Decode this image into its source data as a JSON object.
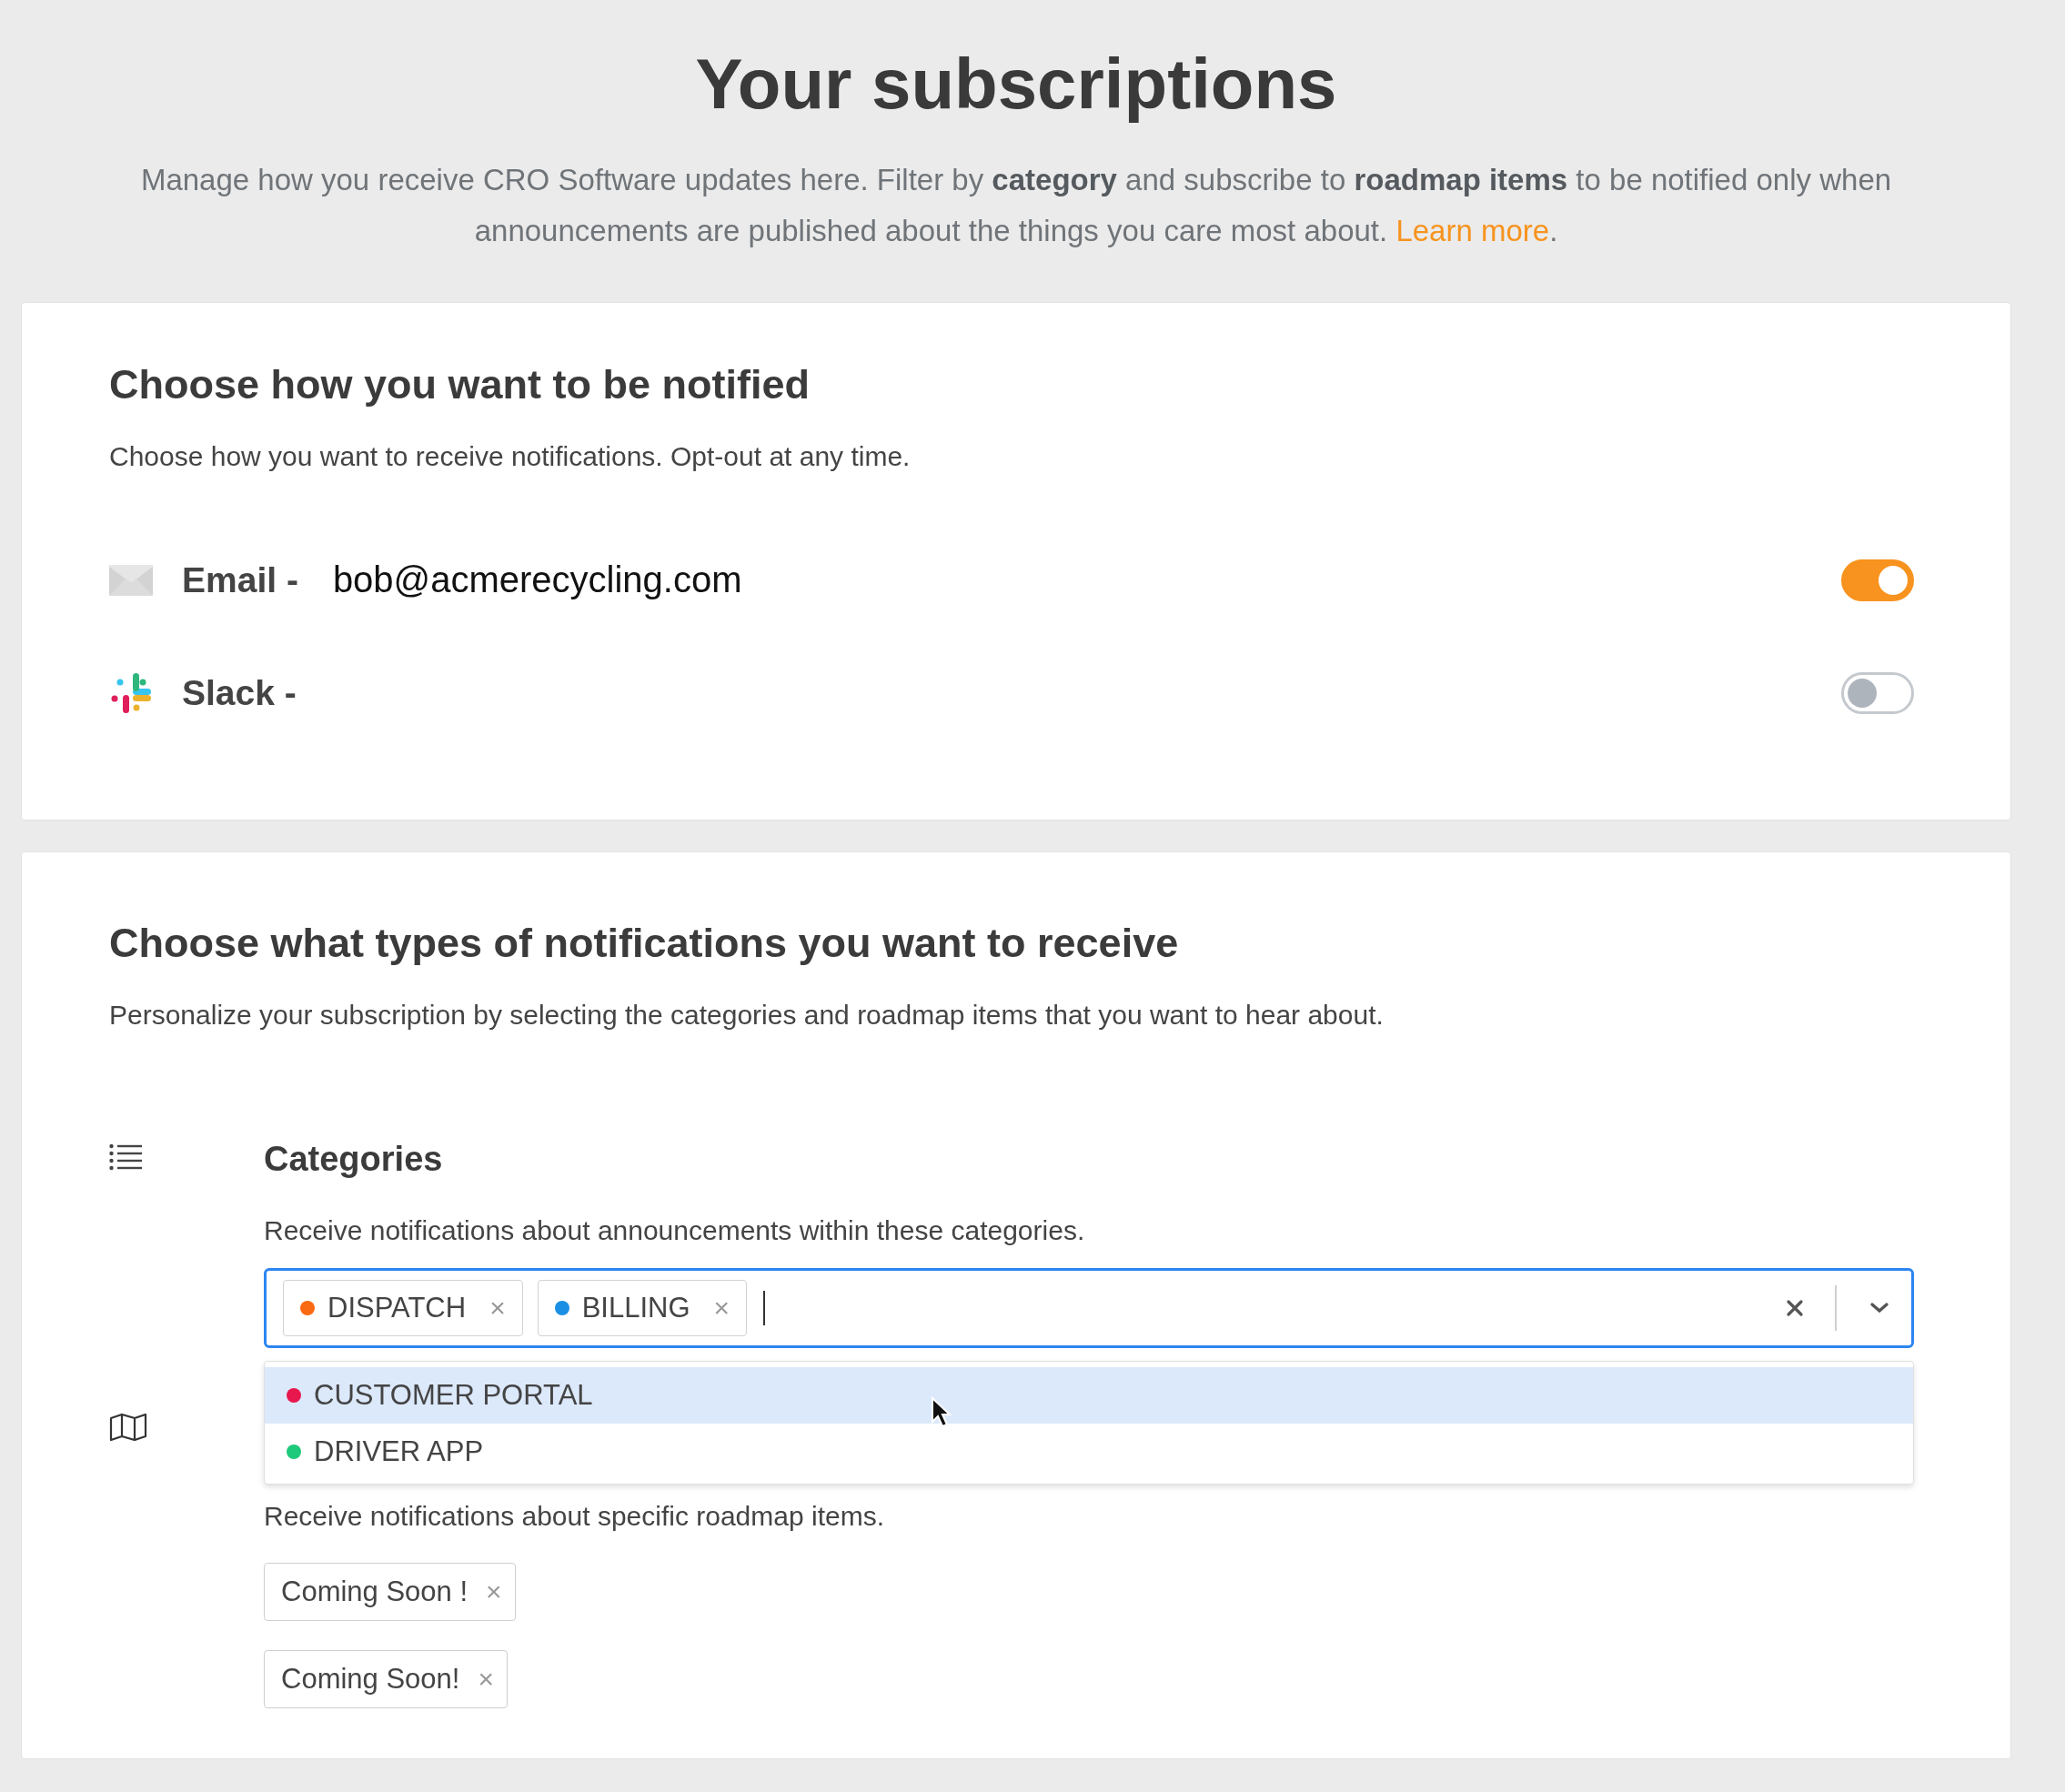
{
  "page_title": "Your subscriptions",
  "intro": {
    "text": "Manage how you receive CRO Software updates here. Filter by **category** and subscribe to **roadmap items** to be notified only when announcements are published about the things you care most about.",
    "link": "Learn more",
    "after": "."
  },
  "notify_card": {
    "title": "Choose how you want to be notified",
    "description": "Choose how you want to receive notifications. Opt-out at any time.",
    "channels": [
      {
        "kind": "email",
        "label": "Email -",
        "value": "bob@acmerecycling.com",
        "on": true
      },
      {
        "kind": "slack",
        "label": "Slack -",
        "on": false
      }
    ]
  },
  "types_card": {
    "title": "Choose what types of notifications you want to receive",
    "description": "Personalize your subscription by selecting the categories and roadmap items that you want to hear about.",
    "categories": {
      "title": "Categories",
      "description": "Receive notifications about announcements within these categories.",
      "remove_glyph": "×",
      "selected": [
        {
          "label": "DISPATCH",
          "color": "#f96a12"
        },
        {
          "label": "BILLING",
          "color": "#1a8fe3"
        }
      ],
      "options": [
        {
          "label": "CUSTOMER PORTAL",
          "color": "#e8174d",
          "selected": true
        },
        {
          "label": "DRIVER APP",
          "color": "#1dc97a",
          "selected": false
        }
      ]
    },
    "roadmap": {
      "description": "Receive notifications about specific roadmap items.",
      "items": [
        {
          "label": "Coming Soon !"
        },
        {
          "label": "Coming Soon!"
        }
      ]
    }
  }
}
